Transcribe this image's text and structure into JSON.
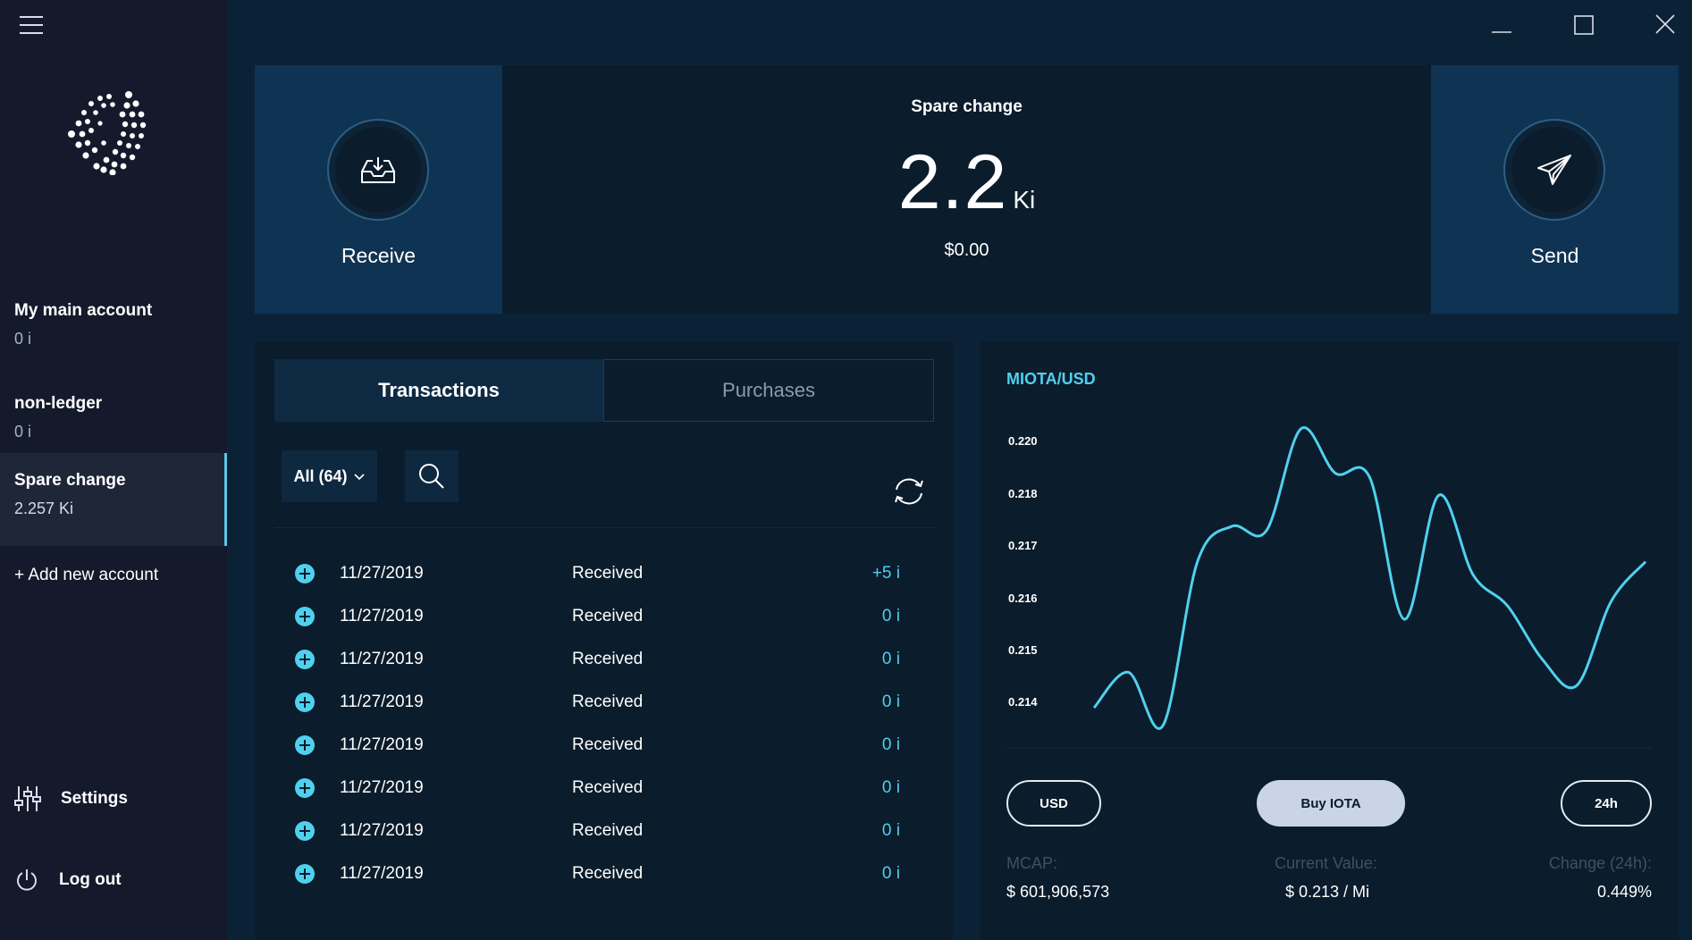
{
  "sidebar": {
    "accounts": [
      {
        "name": "My main account",
        "balance": "0 i"
      },
      {
        "name": "non-ledger",
        "balance": "0 i"
      },
      {
        "name": "Spare change",
        "balance": "2.257 Ki"
      }
    ],
    "add_account": "+ Add new account",
    "settings": "Settings",
    "logout": "Log out"
  },
  "balance_card": {
    "receive_label": "Receive",
    "send_label": "Send",
    "account_name": "Spare change",
    "amount": "2.2",
    "unit": "Ki",
    "fiat": "$0.00"
  },
  "transactions": {
    "tabs": [
      "Transactions",
      "Purchases"
    ],
    "filter_label": "All (64)",
    "rows": [
      {
        "date": "11/27/2019",
        "type": "Received",
        "amount": "+5 i"
      },
      {
        "date": "11/27/2019",
        "type": "Received",
        "amount": "0 i"
      },
      {
        "date": "11/27/2019",
        "type": "Received",
        "amount": "0 i"
      },
      {
        "date": "11/27/2019",
        "type": "Received",
        "amount": "0 i"
      },
      {
        "date": "11/27/2019",
        "type": "Received",
        "amount": "0 i"
      },
      {
        "date": "11/27/2019",
        "type": "Received",
        "amount": "0 i"
      },
      {
        "date": "11/27/2019",
        "type": "Received",
        "amount": "0 i"
      },
      {
        "date": "11/27/2019",
        "type": "Received",
        "amount": "0 i"
      }
    ]
  },
  "market": {
    "title": "MIOTA/USD",
    "currency_button": "USD",
    "buy_button": "Buy IOTA",
    "timeframe_button": "24h",
    "mcap_label": "MCAP:",
    "mcap_value": "$ 601,906,573",
    "current_label": "Current Value:",
    "current_value": "$ 0.213 / Mi",
    "change_label": "Change (24h):",
    "change_value": "0.449%"
  },
  "chart_data": {
    "type": "line",
    "title": "MIOTA/USD",
    "xlabel": "",
    "ylabel": "",
    "ytick_labels": [
      "0.220",
      "0.218",
      "0.217",
      "0.216",
      "0.215",
      "0.214"
    ],
    "ylim": [
      0.2138,
      0.2203
    ],
    "grid": false,
    "color": "#4fd1ee",
    "series": [
      {
        "values": [
          0.214,
          0.2148,
          0.2136,
          0.2173,
          0.2181,
          0.218,
          0.2203,
          0.2193,
          0.2192,
          0.216,
          0.2188,
          0.217,
          0.2163,
          0.2151,
          0.2145,
          0.2164,
          0.2173
        ]
      }
    ]
  },
  "colors": {
    "accent": "#4fd1ee",
    "sidebar_bg": "#141a2b",
    "main_bg": "#0b2236",
    "card_bg": "#0b1c2c",
    "panel_bg": "#0f3352"
  },
  "icons": [
    "menu-icon",
    "iota-logo",
    "settings-sliders-icon",
    "power-icon",
    "minimize-icon",
    "maximize-icon",
    "close-icon",
    "inbox-download-icon",
    "paper-plane-icon",
    "chevron-down-icon",
    "search-icon",
    "refresh-icon",
    "plus-circle-icon"
  ]
}
